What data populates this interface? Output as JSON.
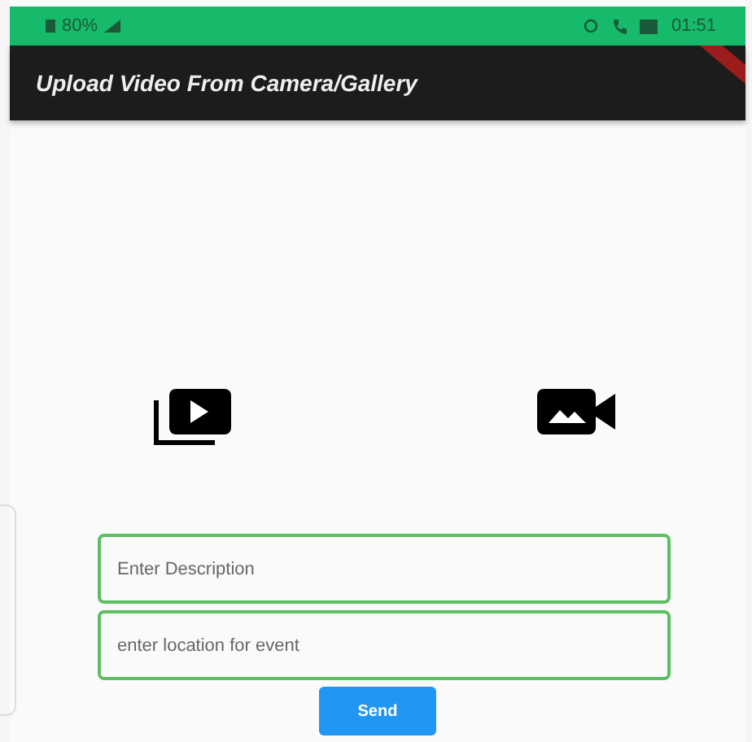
{
  "status_bar": {
    "battery": "80%",
    "time": "01:51"
  },
  "app_bar": {
    "title": "Upload Video From Camera/Gallery",
    "debug_banner": true
  },
  "fields": [
    {
      "placeholder": "Enter Description"
    },
    {
      "placeholder": "enter location for event"
    }
  ],
  "button": "Send"
}
